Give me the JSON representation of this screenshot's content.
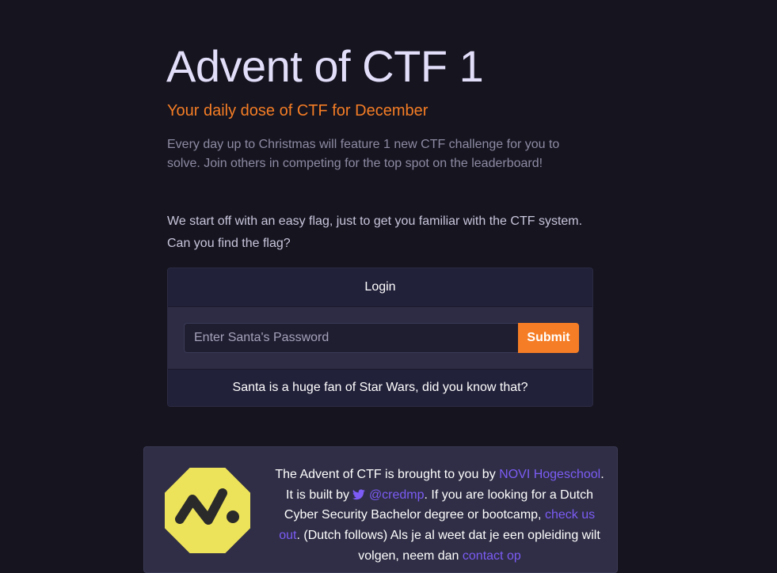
{
  "header": {
    "title": "Advent of CTF 1",
    "subtitle": "Your daily dose of CTF for December",
    "intro": "Every day up to Christmas will feature 1 new CTF challenge for you to solve. Join others in competing for the top spot on the leaderboard!"
  },
  "challenge": {
    "description": "We start off with an easy flag, just to get you familiar with the CTF system. Can you find the flag?"
  },
  "login_card": {
    "header": "Login",
    "password_placeholder": "Enter Santa's Password",
    "password_value": "",
    "submit_label": "Submit",
    "hint": "Santa is a huge fan of Star Wars, did you know that?"
  },
  "sponsor": {
    "logo_icon": "novi-logo-icon",
    "twitter_icon": "twitter-icon",
    "text_1": "The Advent of CTF is brought to you by ",
    "novi_link": "NOVI Hogeschool",
    "text_2": ". It is built by ",
    "credmp_link": "@credmp",
    "text_3": ". If you are looking for a Dutch Cyber Security Bachelor degree or bootcamp, ",
    "check_link": "check us out",
    "text_4": ". (Dutch follows) Als je al weet dat je een opleiding wilt volgen, neem dan ",
    "contact_link": "contact op",
    "logo_color": "#ede35a",
    "link_color": "#7c5cf5"
  },
  "colors": {
    "background": "#15141f",
    "accent": "#f57d25",
    "title": "#e2defa"
  }
}
